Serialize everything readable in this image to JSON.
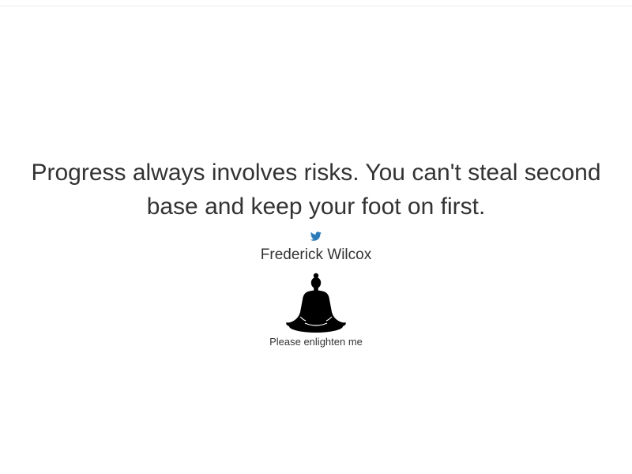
{
  "quote": {
    "text": "Progress always involves risks. You can't steal second base and keep your foot on first.",
    "author": "Frederick Wilcox"
  },
  "share": {
    "icon": "twitter-icon",
    "color": "#1da1f2"
  },
  "new_quote_button": {
    "icon": "meditation-icon",
    "label": "Please enlighten me"
  }
}
